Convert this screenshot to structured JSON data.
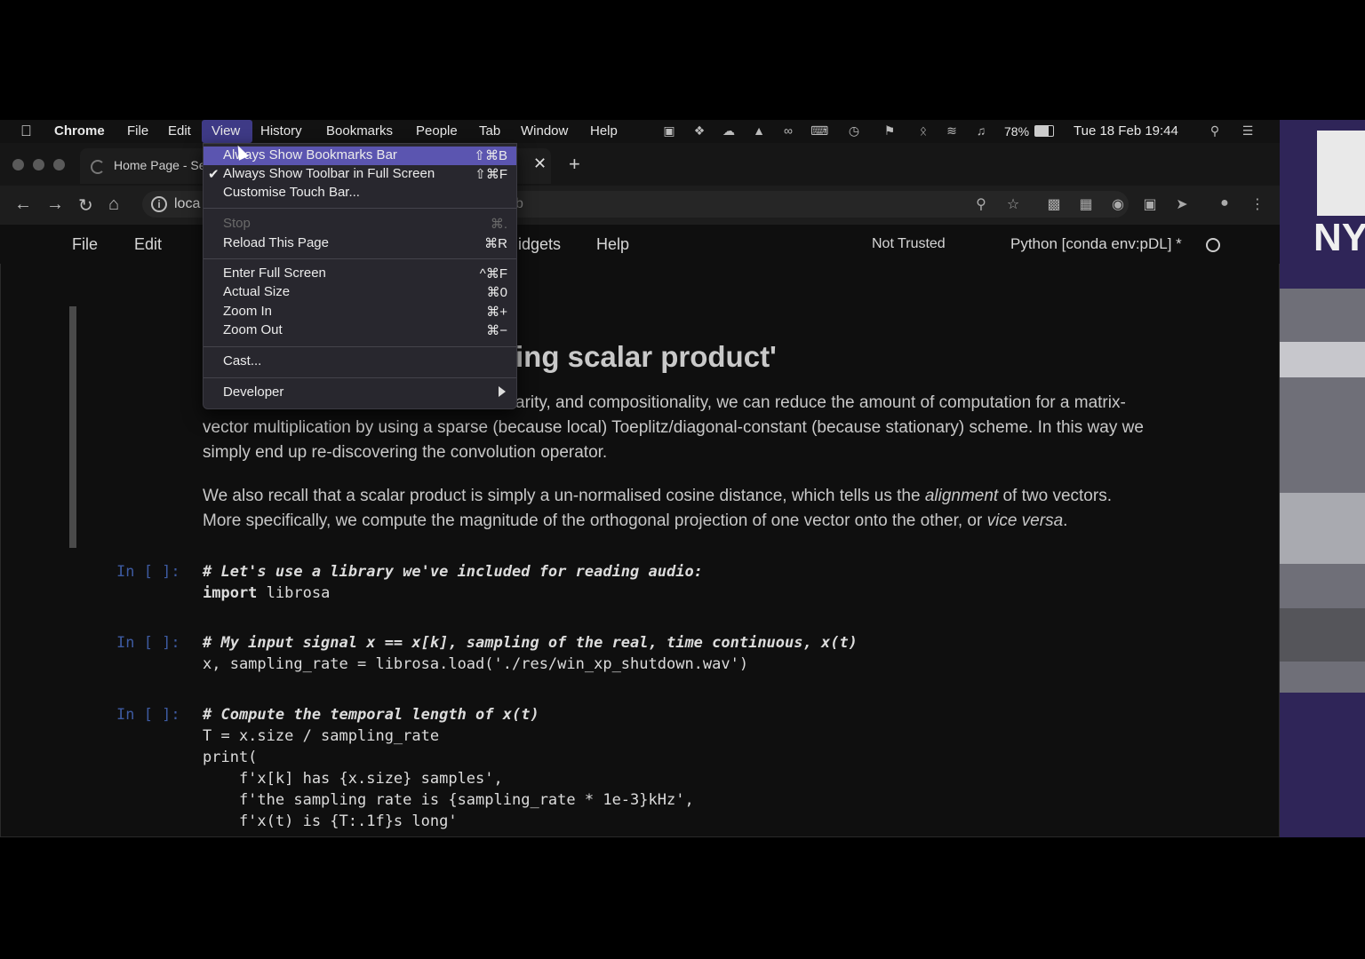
{
  "macos_menubar": {
    "app_name": "Chrome",
    "menus": [
      "File",
      "Edit",
      "View",
      "History",
      "Bookmarks",
      "People",
      "Tab",
      "Window",
      "Help"
    ],
    "active_menu": "View",
    "battery": "78%",
    "datetime": "Tue 18 Feb  19:44"
  },
  "browser": {
    "tab_title": "Home Page - Se",
    "new_tab_label": "+",
    "close_tab_label": "✕",
    "address_partial": "loca",
    "address_tail": "b"
  },
  "view_menu": {
    "sections": [
      [
        {
          "label": "Always Show Bookmarks Bar",
          "shortcut": "⇧⌘B",
          "highlighted": true,
          "checked": false,
          "disabled": false
        },
        {
          "label": "Always Show Toolbar in Full Screen",
          "shortcut": "⇧⌘F",
          "highlighted": false,
          "checked": true,
          "disabled": false
        },
        {
          "label": "Customise Touch Bar...",
          "shortcut": "",
          "highlighted": false,
          "checked": false,
          "disabled": false
        }
      ],
      [
        {
          "label": "Stop",
          "shortcut": "⌘.",
          "disabled": true
        },
        {
          "label": "Reload This Page",
          "shortcut": "⌘R",
          "disabled": false
        }
      ],
      [
        {
          "label": "Enter Full Screen",
          "shortcut": "^⌘F",
          "disabled": false
        },
        {
          "label": "Actual Size",
          "shortcut": "⌘0",
          "disabled": false
        },
        {
          "label": "Zoom In",
          "shortcut": "⌘+",
          "disabled": false
        },
        {
          "label": "Zoom Out",
          "shortcut": "⌘−",
          "disabled": false
        }
      ],
      [
        {
          "label": "Cast...",
          "shortcut": "",
          "disabled": false
        }
      ],
      [
        {
          "label": "Developer",
          "shortcut": "",
          "disabled": false,
          "submenu": true
        }
      ]
    ]
  },
  "jupyter": {
    "menu": [
      "File",
      "Edit",
      "idgets",
      "Help"
    ],
    "trust_status": "Not Trusted",
    "kernel": "Python [conda env:pDL] *"
  },
  "notebook": {
    "heading_visible": "ing scalar product'",
    "paragraph1_visible_start": "arity, and compositionality, we can reduce the amount of computation for a matrix-",
    "paragraph1_line2": "vector multiplication by using a sparse (because local) Toeplitz/diagonal-constant (because stationary) scheme. In this way we",
    "paragraph1_line3": "simply end up re-discovering the convolution operator.",
    "paragraph2_line1_a": "We also recall that a scalar product is simply a un-normalised cosine distance, which tells us the ",
    "paragraph2_line1_em": "alignment",
    "paragraph2_line1_b": " of two vectors.",
    "paragraph2_line2_a": "More specifically, we compute the magnitude of the orthogonal projection of one vector onto the other, or ",
    "paragraph2_line2_em": "vice versa",
    "paragraph2_line2_b": ".",
    "cells": [
      {
        "prompt": "In [ ]:",
        "comment": "# Let's use a library we've included for reading audio:",
        "lines": [
          [
            "import",
            " librosa"
          ]
        ]
      },
      {
        "prompt": "In [ ]:",
        "comment": "# My input signal x == x[k], sampling of the real, time continuous, x(t)",
        "lines": [
          [
            "",
            "x, sampling_rate = librosa.load('./res/win_xp_shutdown.wav')"
          ]
        ]
      },
      {
        "prompt": "In [ ]:",
        "comment": "# Compute the temporal length of x(t)",
        "lines": [
          [
            "",
            "T = x.size / sampling_rate"
          ],
          [
            "",
            "print("
          ],
          [
            "",
            "    f'x[k] has {x.size} samples',"
          ],
          [
            "",
            "    f'the sampling rate is {sampling_rate * 1e-3}kHz',"
          ],
          [
            "",
            "    f'x(t) is {T:.1f}s long'"
          ]
        ]
      }
    ]
  },
  "sidebar_thumbnail": {
    "logo_text": "NY"
  }
}
